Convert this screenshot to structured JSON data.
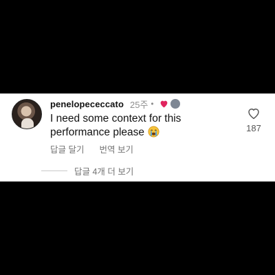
{
  "comment": {
    "username": "penelopececcato",
    "time": "25주",
    "separator": "•",
    "text": "I need some context for this performance please",
    "emoji_icon": "crying-face-icon",
    "reaction_badges": [
      "red-heart-icon",
      "gray-circle-icon"
    ],
    "actions": {
      "reply": "답글 달기",
      "translate": "번역 보기"
    },
    "view_replies": "답글 4개 더 보기",
    "like_count": "187"
  },
  "colors": {
    "background": "#000000",
    "panel": "#ffffff",
    "heart_badge": "#e0245e",
    "muted_text": "#737373"
  }
}
